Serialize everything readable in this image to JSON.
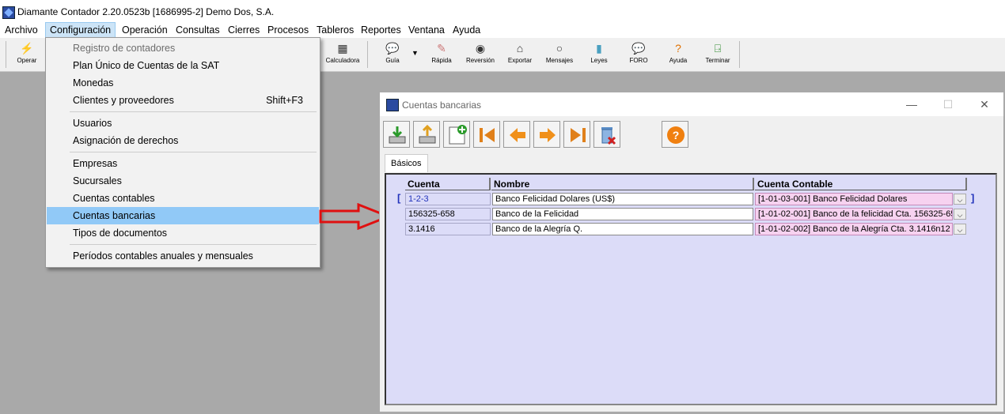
{
  "window_title": "Diamante Contador 2.20.0523b [1686995-2] Demo Dos, S.A.",
  "menubar": [
    "Archivo",
    "Configuración",
    "Operación",
    "Consultas",
    "Cierres",
    "Procesos",
    "Tableros",
    "Reportes",
    "Ventana",
    "Ayuda"
  ],
  "toolbar": {
    "operar": "Operar",
    "calculadora": "Calculadora",
    "guia": "Guía",
    "rapida": "Rápida",
    "reversion": "Reversión",
    "exportar": "Exportar",
    "mensajes": "Mensajes",
    "leyes": "Leyes",
    "foro": "FORO",
    "ayuda": "Ayuda",
    "terminar": "Terminar"
  },
  "dropdown": {
    "items": [
      {
        "label": "Registro de contadores",
        "shortcut": ""
      },
      {
        "label": "Plan Único de Cuentas de la SAT",
        "shortcut": ""
      },
      {
        "label": "Monedas",
        "shortcut": ""
      },
      {
        "label": "Clientes y proveedores",
        "shortcut": "Shift+F3"
      },
      {
        "label": "Usuarios",
        "shortcut": ""
      },
      {
        "label": "Asignación de derechos",
        "shortcut": ""
      },
      {
        "label": "Empresas",
        "shortcut": ""
      },
      {
        "label": "Sucursales",
        "shortcut": ""
      },
      {
        "label": "Cuentas contables",
        "shortcut": ""
      },
      {
        "label": "Cuentas bancarias",
        "shortcut": ""
      },
      {
        "label": "Tipos de documentos",
        "shortcut": ""
      },
      {
        "label": "Períodos contables anuales y mensuales",
        "shortcut": ""
      }
    ]
  },
  "bank_window": {
    "title": "Cuentas bancarias",
    "tab": "Básicos",
    "columns": [
      "Cuenta",
      "Nombre",
      "Cuenta Contable"
    ],
    "rows": [
      {
        "cuenta": "1-2-3",
        "nombre": "Banco Felicidad Dolares (US$)",
        "cuenta_contable": "[1-01-03-001]  Banco Felicidad Dolares"
      },
      {
        "cuenta": "156325-658",
        "nombre": "Banco de la Felicidad",
        "cuenta_contable": "[1-01-02-001]  Banco de la felicidad Cta. 156325-65"
      },
      {
        "cuenta": "3.1416",
        "nombre": "Banco de la Alegría Q.",
        "cuenta_contable": "[1-01-02-002]  Banco de la Alegría Cta. 3.1416n12"
      }
    ],
    "bracket_open": "[",
    "bracket_close": "]"
  }
}
